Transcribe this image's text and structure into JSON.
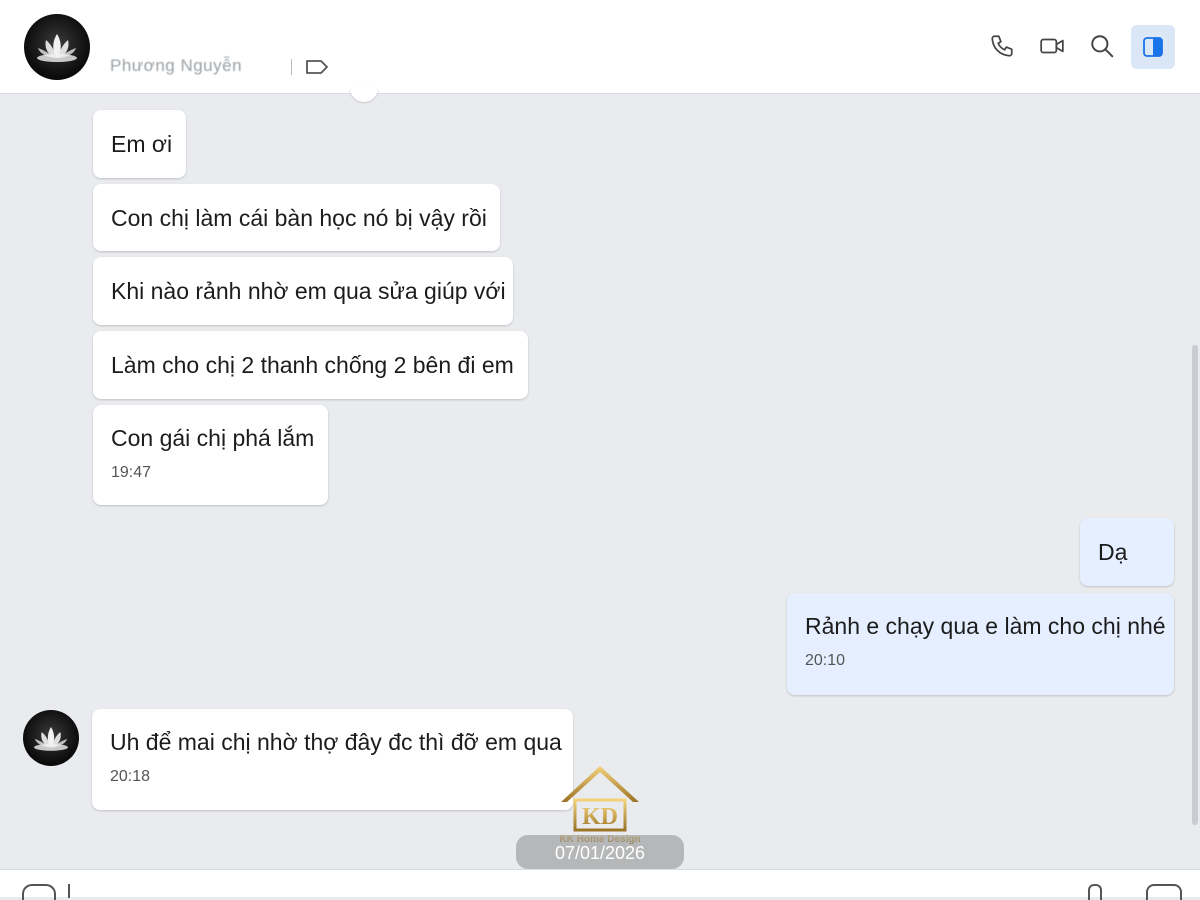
{
  "header": {
    "contact_name": "Phương Nguyễn",
    "icons": [
      "phone-icon",
      "video-icon",
      "search-icon",
      "panel-toggle-icon"
    ],
    "accent": "#1a73e8"
  },
  "messages": [
    {
      "text": "Em ơi"
    },
    {
      "text": "Con chị làm cái bàn học nó bị vậy rồi"
    },
    {
      "text": "Khi nào rảnh nhờ em qua sửa giúp với"
    },
    {
      "text": "Làm cho chị 2 thanh chống 2 bên đi em"
    },
    {
      "text": "Con gái chị phá lắm",
      "time": "19:47"
    },
    {
      "text": "Dạ"
    },
    {
      "text": "Rảnh e chạy qua e làm cho chị nhé",
      "time": "20:10"
    },
    {
      "text": "Uh để mai chị nhờ thợ đây đc thì đỡ em qua",
      "time": "20:18"
    }
  ],
  "date_stamp": "07/01/2026",
  "watermark": {
    "initials": "KD",
    "text": "KK Home Design",
    "color": "#c9a24a"
  },
  "colors": {
    "received_bubble": "#ffffff",
    "sent_bubble": "#e5efff",
    "background": "#e9ebee"
  }
}
